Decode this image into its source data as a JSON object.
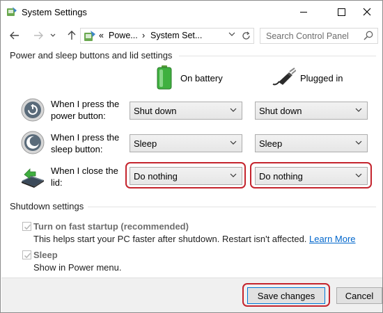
{
  "window": {
    "title": "System Settings",
    "icons": {
      "app": "control-panel-icon",
      "minimize": "minimize-icon",
      "maximize": "maximize-icon",
      "close": "close-icon"
    }
  },
  "nav": {
    "back_icon": "arrow-left-icon",
    "forward_icon": "arrow-right-icon",
    "recent_icon": "chevron-down-icon",
    "up_icon": "arrow-up-icon",
    "address": {
      "overflow": "«",
      "segments": [
        "Powe...",
        "System Set..."
      ],
      "separator": "›"
    },
    "refresh_icon": "refresh-icon",
    "search": {
      "placeholder": "Search Control Panel",
      "value": ""
    }
  },
  "power_section": {
    "heading": "Power and sleep buttons and lid settings",
    "columns": [
      {
        "label": "On battery",
        "icon": "battery-icon"
      },
      {
        "label": "Plugged in",
        "icon": "power-plug-icon"
      }
    ],
    "rows": [
      {
        "label": "When I press the power button:",
        "icon": "power-button-icon",
        "battery": "Shut down",
        "plugged": "Shut down"
      },
      {
        "label": "When I press the sleep button:",
        "icon": "sleep-button-icon",
        "battery": "Sleep",
        "plugged": "Sleep"
      },
      {
        "label": "When I close the lid:",
        "icon": "laptop-lid-icon",
        "battery": "Do nothing",
        "plugged": "Do nothing"
      }
    ]
  },
  "shutdown_section": {
    "heading": "Shutdown settings",
    "fast_startup": {
      "label": "Turn on fast startup (recommended)",
      "checked": true,
      "description": "This helps start your PC faster after shutdown. Restart isn't affected.",
      "link": "Learn More"
    },
    "sleep": {
      "label": "Sleep",
      "checked": true,
      "description": "Show in Power menu."
    }
  },
  "footer": {
    "save_label": "Save changes",
    "cancel_label": "Cancel"
  },
  "colors": {
    "highlight": "#c4242d",
    "link": "#0066cc",
    "accent": "#0078d7"
  }
}
